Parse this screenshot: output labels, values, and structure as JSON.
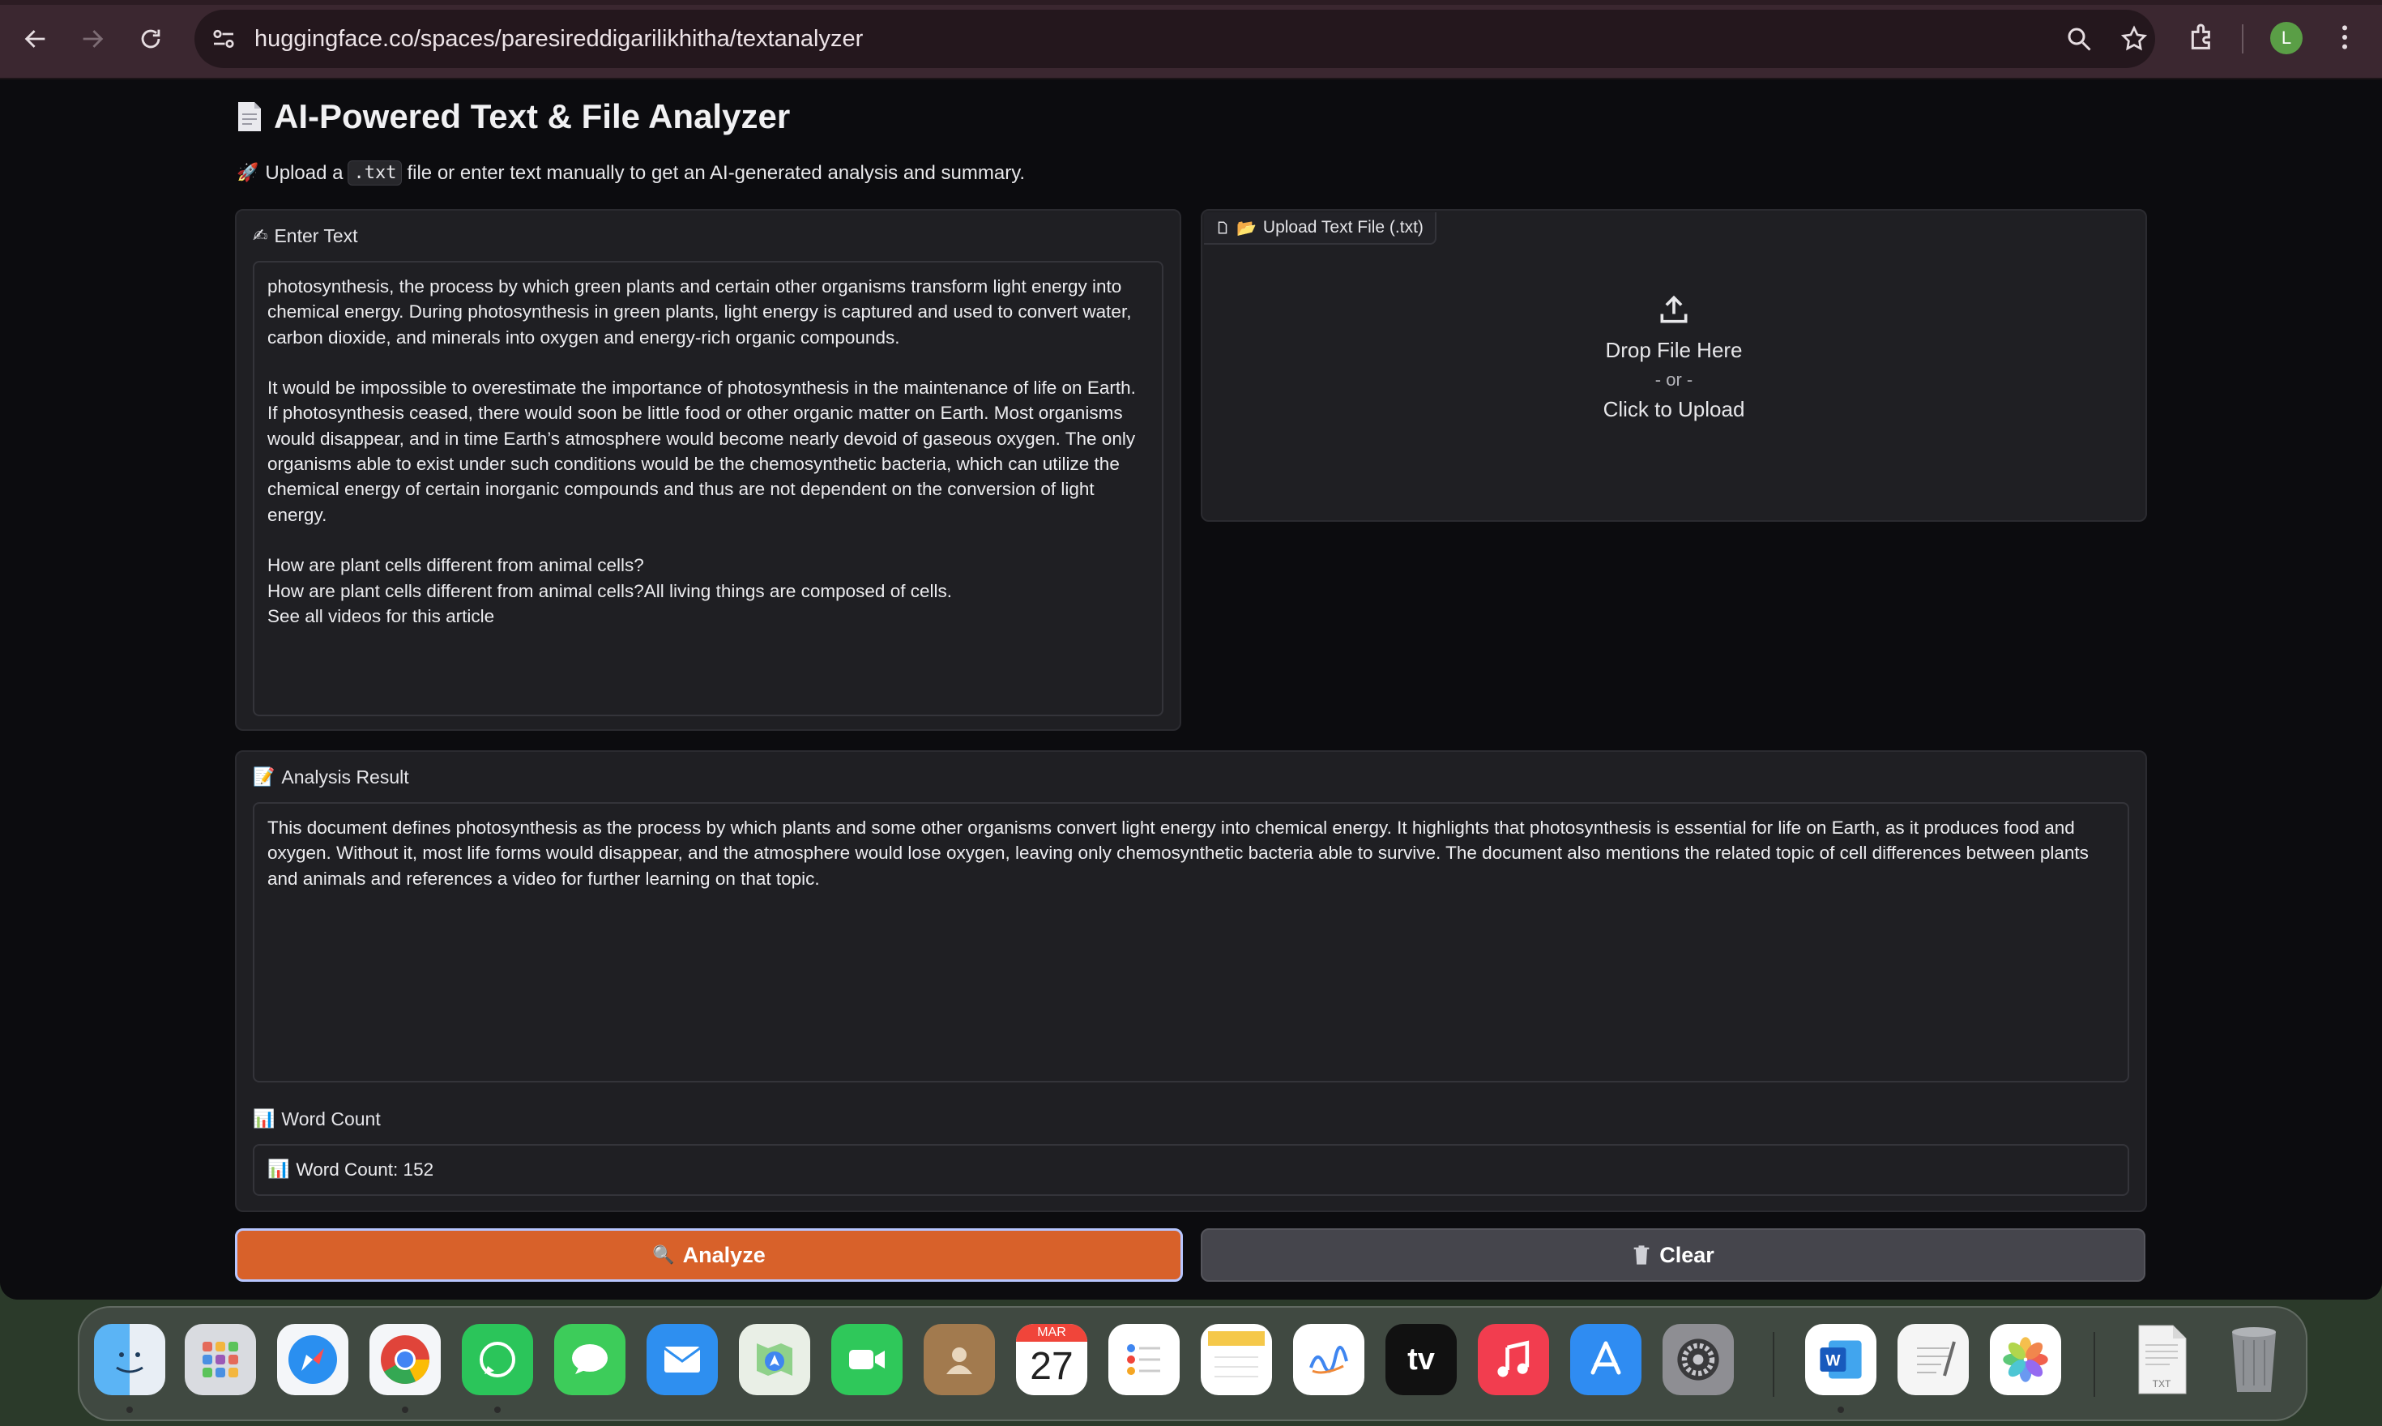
{
  "browser": {
    "url": "huggingface.co/spaces/paresireddigarilikhitha/textanalyzer",
    "profile_initial": "L"
  },
  "app": {
    "title": "AI-Powered Text & File Analyzer",
    "subtitle_prefix": "Upload a",
    "subtitle_code": ".txt",
    "subtitle_suffix": "file or enter text manually to get an AI-generated analysis and summary."
  },
  "input_panel": {
    "label": "Enter Text",
    "text": "photosynthesis, the process by which green plants and certain other organisms transform light energy into chemical energy. During photosynthesis in green plants, light energy is captured and used to convert water, carbon dioxide, and minerals into oxygen and energy-rich organic compounds.\n\nIt would be impossible to overestimate the importance of photosynthesis in the maintenance of life on Earth. If photosynthesis ceased, there would soon be little food or other organic matter on Earth. Most organisms would disappear, and in time Earth’s atmosphere would become nearly devoid of gaseous oxygen. The only organisms able to exist under such conditions would be the chemosynthetic bacteria, which can utilize the chemical energy of certain inorganic compounds and thus are not dependent on the conversion of light energy.\n\nHow are plant cells different from animal cells?\nHow are plant cells different from animal cells?All living things are composed of cells.\nSee all videos for this article"
  },
  "upload_panel": {
    "tab_label": "Upload Text File (.txt)",
    "drop_text": "Drop File Here",
    "or_text": "- or -",
    "click_text": "Click to Upload"
  },
  "result_panel": {
    "label": "Analysis Result",
    "text": "This document defines photosynthesis as the process by which plants and some other organisms convert light energy into chemical energy. It highlights that photosynthesis is essential for life on Earth, as it produces food and oxygen. Without it, most life forms would disappear, and the atmosphere would lose oxygen, leaving only chemosynthetic bacteria able to survive. The document also mentions the related topic of cell differences between plants and animals and references a video for further learning on that topic."
  },
  "word_count_panel": {
    "label": "Word Count",
    "value": "Word Count: 152"
  },
  "buttons": {
    "analyze": "Analyze",
    "clear": "Clear"
  },
  "dock": {
    "calendar_month": "MAR",
    "calendar_day": "27",
    "tv_label": "tv",
    "txt_label": "TXT",
    "items": [
      "finder-icon",
      "launchpad-icon",
      "safari-icon",
      "chrome-icon",
      "whatsapp-icon",
      "messages-icon",
      "mail-icon",
      "maps-icon",
      "facetime-icon",
      "contacts-icon",
      "calendar-icon",
      "reminders-icon",
      "notes-icon",
      "freeform-icon",
      "apple-tv-icon",
      "music-icon",
      "app-store-icon",
      "system-settings-icon",
      "word-icon",
      "textedit-icon",
      "photos-icon",
      "txt-file-icon",
      "trash-icon"
    ]
  },
  "colors": {
    "accent_orange": "#d8612a",
    "browser_frame": "#3b2730",
    "panel_bg": "#1f1f23"
  }
}
